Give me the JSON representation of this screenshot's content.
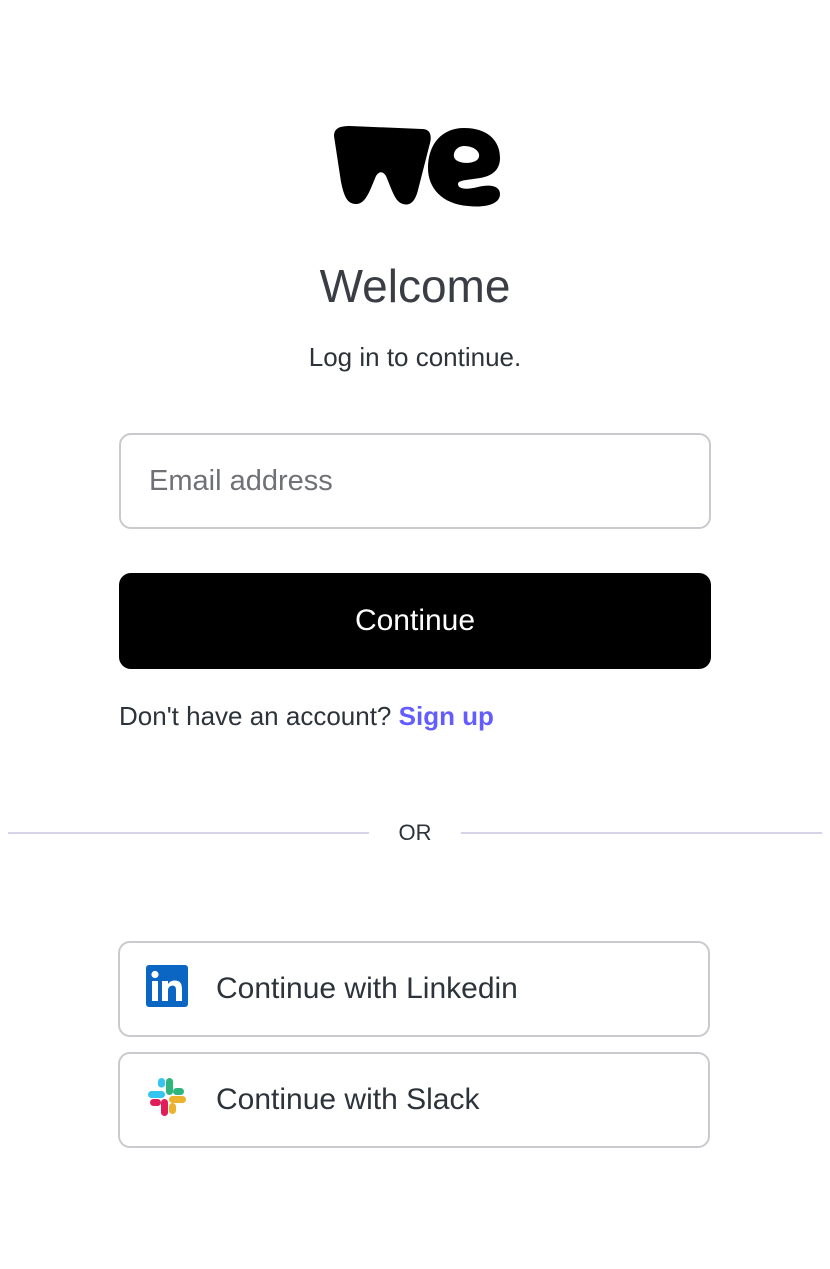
{
  "brand": {
    "logo_icon": "wetransfer-we-logo",
    "logo_color": "#000000"
  },
  "header": {
    "title": "Welcome",
    "subtitle": "Log in to continue."
  },
  "form": {
    "email_placeholder": "Email address",
    "email_value": "",
    "continue_label": "Continue"
  },
  "signup": {
    "prompt": "Don't have an account?",
    "link_label": "Sign up",
    "link_color": "#635dff"
  },
  "divider": {
    "label": "OR"
  },
  "social": {
    "linkedin": {
      "label": "Continue with Linkedin",
      "icon": "linkedin-icon",
      "color": "#0a66c2"
    },
    "slack": {
      "label": "Continue with Slack",
      "icon": "slack-icon",
      "colors": [
        "#36c5f0",
        "#2eb67d",
        "#ecb22e",
        "#e01e5a"
      ]
    }
  },
  "colors": {
    "primary_button": "#000000",
    "border": "#c9cace"
  }
}
